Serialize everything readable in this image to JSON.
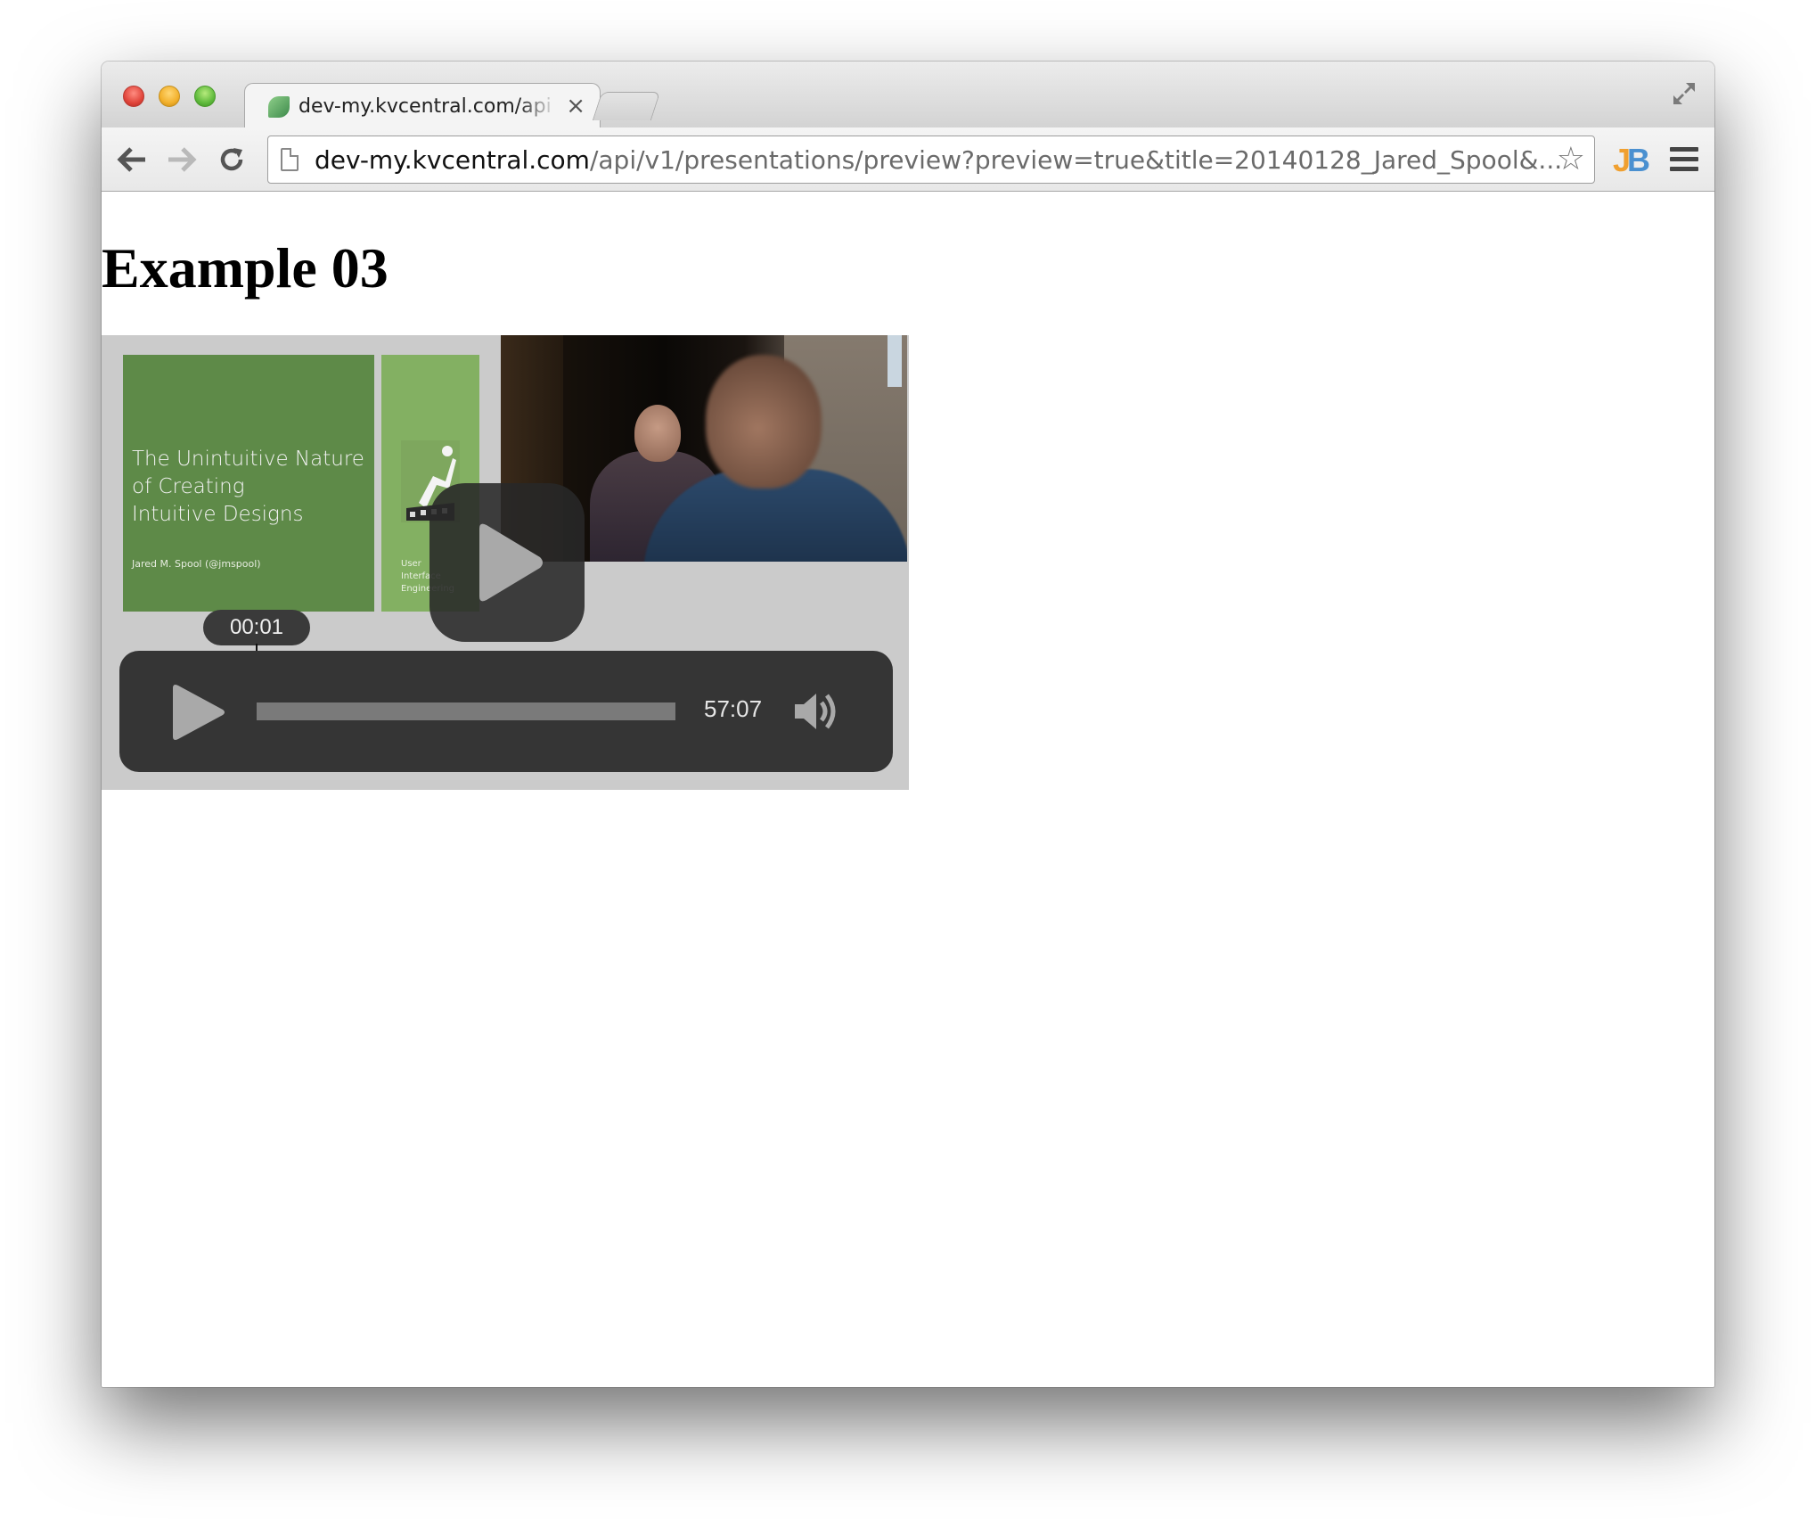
{
  "browser": {
    "tab_title": "dev-my.kvcentral.com/api",
    "tab_close": "×",
    "url_host": "dev-my.kvcentral.com",
    "url_path": "/api/v1/presentations/preview?preview=true&title=20140128_Jared_Spool&...",
    "extension_j": "J",
    "extension_b": "B"
  },
  "page": {
    "heading": "Example 03"
  },
  "slide": {
    "title": "The Unintuitive Nature\nof Creating\nIntuitive Designs",
    "author": "Jared M. Spool (@jmspool)",
    "side_text": "User\nInterface\nEngineering"
  },
  "player": {
    "hover_time": "00:01",
    "duration": "57:07",
    "progress": 0.0
  },
  "colors": {
    "slide_green": "#5e8a48",
    "slide_side_green": "#83b062",
    "controls_bg": "#353535"
  }
}
